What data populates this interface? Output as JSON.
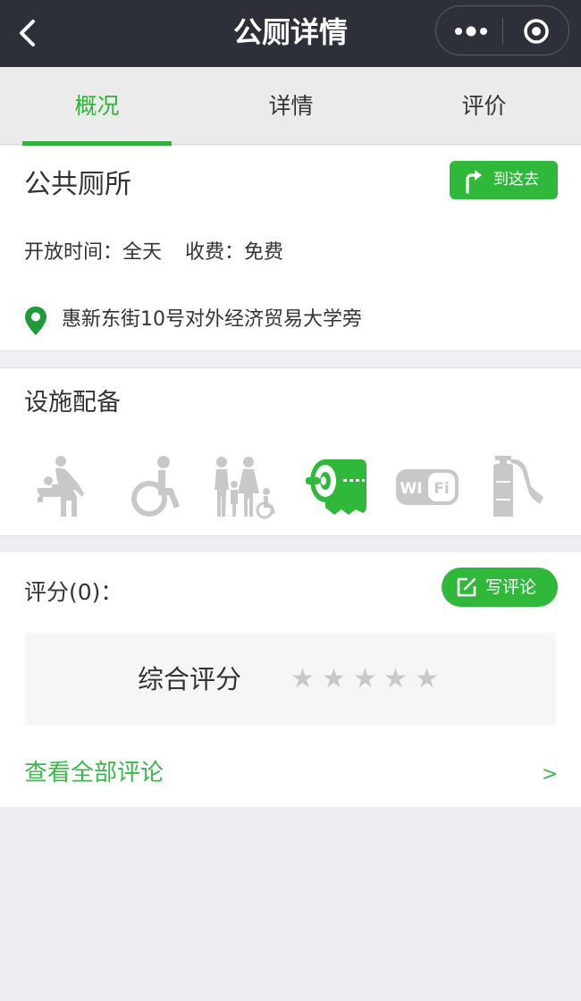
{
  "navbar": {
    "title": "公厕详情",
    "back_icon": "chevron-left-icon",
    "more_icon": "more-dots-icon",
    "close_icon": "target-close-icon",
    "background": "#2d3038"
  },
  "tabs": [
    {
      "label": "概况",
      "active": true
    },
    {
      "label": "详情",
      "active": false
    },
    {
      "label": "评价",
      "active": false
    }
  ],
  "info": {
    "name": "公共厕所",
    "go_button": "到这去",
    "hours_label": "开放时间：",
    "hours_value": "全天",
    "fee_label": "收费：",
    "fee_value": "免费",
    "address": "惠新东街10号对外经济贸易大学旁"
  },
  "facilities": {
    "title": "设施配备",
    "items": [
      {
        "icon": "baby-changing-icon",
        "available": false
      },
      {
        "icon": "wheelchair-icon",
        "available": false
      },
      {
        "icon": "family-restroom-icon",
        "available": false
      },
      {
        "icon": "toilet-paper-icon",
        "available": true
      },
      {
        "icon": "wifi-icon",
        "available": false
      },
      {
        "icon": "fire-extinguisher-icon",
        "available": false
      }
    ]
  },
  "rating": {
    "title": "评分(0)：",
    "write_button": "写评论",
    "overall_label": "综合评分",
    "stars": [
      "★",
      "★",
      "★",
      "★",
      "★"
    ],
    "star_value": 0,
    "view_all": "查看全部评论",
    "view_all_arrow": ">"
  },
  "colors": {
    "accent": "#2fb83a",
    "inactive_icon": "#c8c8c8"
  }
}
